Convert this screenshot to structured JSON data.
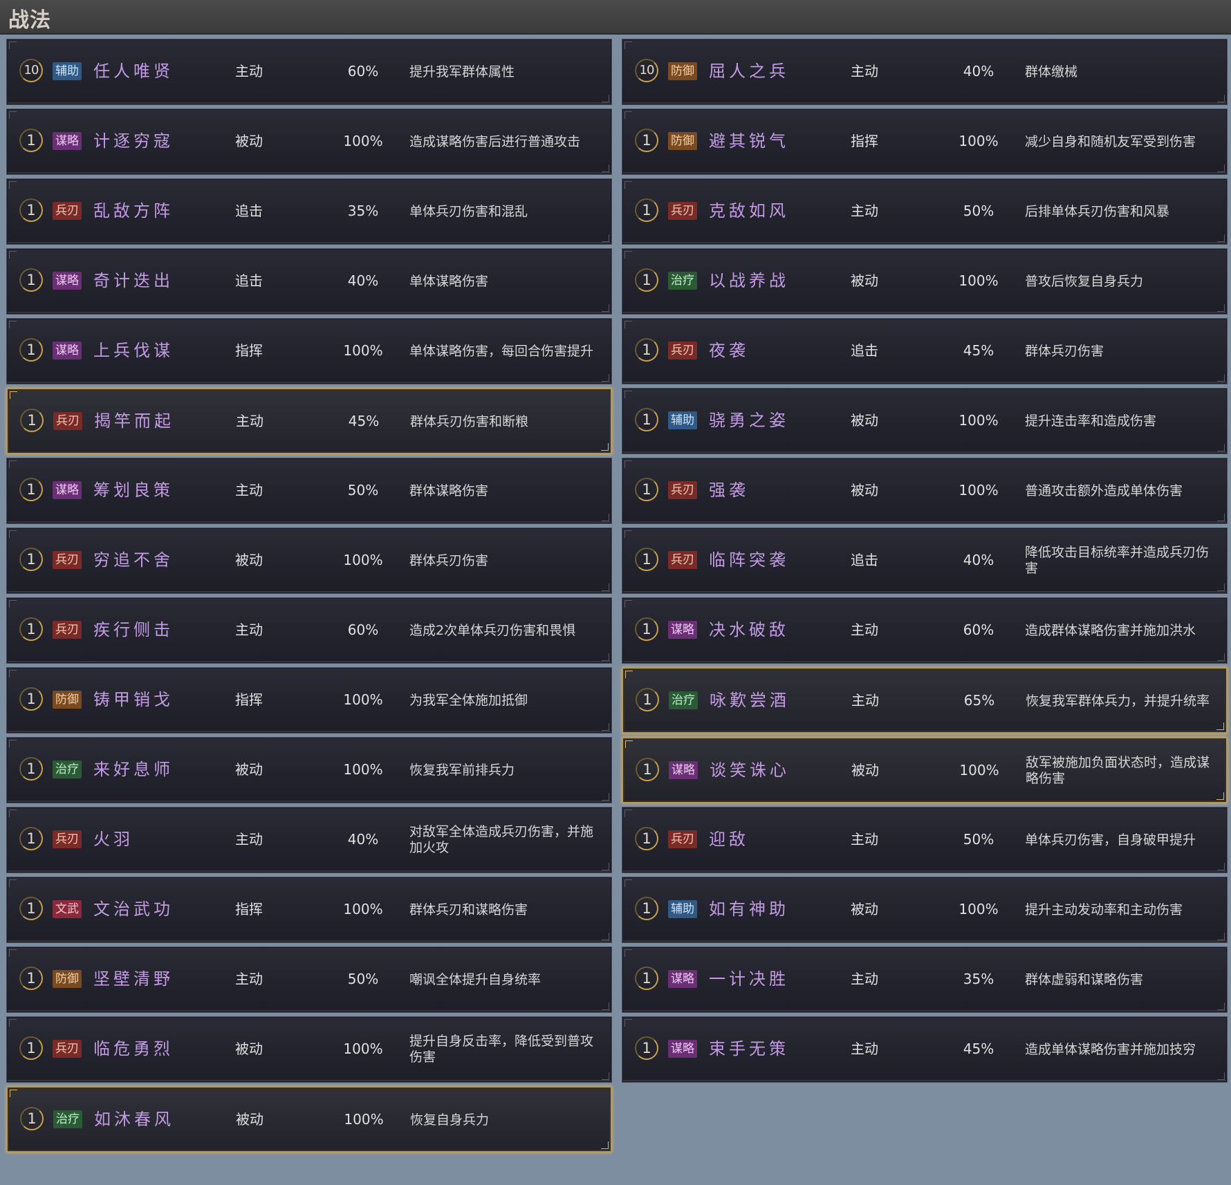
{
  "header": {
    "title": "战法"
  },
  "left_column": [
    {
      "level": "10",
      "tag": "辅助",
      "tag_kind": "support",
      "name": "任人唯贤",
      "type": "主动",
      "rate": "60%",
      "desc": "提升我军群体属性",
      "highlight": false
    },
    {
      "level": "1",
      "tag": "谋略",
      "tag_kind": "strategy",
      "name": "计逐穷寇",
      "type": "被动",
      "rate": "100%",
      "desc": "造成谋略伤害后进行普通攻击",
      "highlight": false
    },
    {
      "level": "1",
      "tag": "兵刃",
      "tag_kind": "blade",
      "name": "乱敌方阵",
      "type": "追击",
      "rate": "35%",
      "desc": "单体兵刃伤害和混乱",
      "highlight": false
    },
    {
      "level": "1",
      "tag": "谋略",
      "tag_kind": "strategy",
      "name": "奇计迭出",
      "type": "追击",
      "rate": "40%",
      "desc": "单体谋略伤害",
      "highlight": false
    },
    {
      "level": "1",
      "tag": "谋略",
      "tag_kind": "strategy",
      "name": "上兵伐谋",
      "type": "指挥",
      "rate": "100%",
      "desc": "单体谋略伤害，每回合伤害提升",
      "highlight": false
    },
    {
      "level": "1",
      "tag": "兵刃",
      "tag_kind": "blade",
      "name": "揭竿而起",
      "type": "主动",
      "rate": "45%",
      "desc": "群体兵刃伤害和断粮",
      "highlight": true
    },
    {
      "level": "1",
      "tag": "谋略",
      "tag_kind": "strategy",
      "name": "筹划良策",
      "type": "主动",
      "rate": "50%",
      "desc": "群体谋略伤害",
      "highlight": false
    },
    {
      "level": "1",
      "tag": "兵刃",
      "tag_kind": "blade",
      "name": "穷追不舍",
      "type": "被动",
      "rate": "100%",
      "desc": "群体兵刃伤害",
      "highlight": false
    },
    {
      "level": "1",
      "tag": "兵刃",
      "tag_kind": "blade",
      "name": "疾行侧击",
      "type": "主动",
      "rate": "60%",
      "desc": "造成2次单体兵刃伤害和畏惧",
      "highlight": false
    },
    {
      "level": "1",
      "tag": "防御",
      "tag_kind": "defense",
      "name": "铸甲销戈",
      "type": "指挥",
      "rate": "100%",
      "desc": "为我军全体施加抵御",
      "highlight": false
    },
    {
      "level": "1",
      "tag": "治疗",
      "tag_kind": "heal",
      "name": "来好息师",
      "type": "被动",
      "rate": "100%",
      "desc": "恢复我军前排兵力",
      "highlight": false
    },
    {
      "level": "1",
      "tag": "兵刃",
      "tag_kind": "blade",
      "name": "火羽",
      "type": "主动",
      "rate": "40%",
      "desc": "对敌军全体造成兵刃伤害，并施加火攻",
      "highlight": false
    },
    {
      "level": "1",
      "tag": "文武",
      "tag_kind": "civil",
      "name": "文治武功",
      "type": "指挥",
      "rate": "100%",
      "desc": "群体兵刃和谋略伤害",
      "highlight": false
    },
    {
      "level": "1",
      "tag": "防御",
      "tag_kind": "defense",
      "name": "坚壁清野",
      "type": "主动",
      "rate": "50%",
      "desc": "嘲讽全体提升自身统率",
      "highlight": false
    },
    {
      "level": "1",
      "tag": "兵刃",
      "tag_kind": "blade",
      "name": "临危勇烈",
      "type": "被动",
      "rate": "100%",
      "desc": "提升自身反击率，降低受到普攻伤害",
      "highlight": false
    },
    {
      "level": "1",
      "tag": "治疗",
      "tag_kind": "heal",
      "name": "如沐春风",
      "type": "被动",
      "rate": "100%",
      "desc": "恢复自身兵力",
      "highlight": true
    }
  ],
  "right_column": [
    {
      "level": "10",
      "tag": "防御",
      "tag_kind": "defense",
      "name": "屈人之兵",
      "type": "主动",
      "rate": "40%",
      "desc": "群体缴械",
      "highlight": false
    },
    {
      "level": "1",
      "tag": "防御",
      "tag_kind": "defense",
      "name": "避其锐气",
      "type": "指挥",
      "rate": "100%",
      "desc": "减少自身和随机友军受到伤害",
      "highlight": false
    },
    {
      "level": "1",
      "tag": "兵刃",
      "tag_kind": "blade",
      "name": "克敌如风",
      "type": "主动",
      "rate": "50%",
      "desc": "后排单体兵刃伤害和风暴",
      "highlight": false
    },
    {
      "level": "1",
      "tag": "治疗",
      "tag_kind": "heal",
      "name": "以战养战",
      "type": "被动",
      "rate": "100%",
      "desc": "普攻后恢复自身兵力",
      "highlight": false
    },
    {
      "level": "1",
      "tag": "兵刃",
      "tag_kind": "blade",
      "name": "夜袭",
      "type": "追击",
      "rate": "45%",
      "desc": "群体兵刃伤害",
      "highlight": false
    },
    {
      "level": "1",
      "tag": "辅助",
      "tag_kind": "support",
      "name": "骁勇之姿",
      "type": "被动",
      "rate": "100%",
      "desc": "提升连击率和造成伤害",
      "highlight": false
    },
    {
      "level": "1",
      "tag": "兵刃",
      "tag_kind": "blade",
      "name": "强袭",
      "type": "被动",
      "rate": "100%",
      "desc": "普通攻击额外造成单体伤害",
      "highlight": false
    },
    {
      "level": "1",
      "tag": "兵刃",
      "tag_kind": "blade",
      "name": "临阵突袭",
      "type": "追击",
      "rate": "40%",
      "desc": "降低攻击目标统率并造成兵刃伤害",
      "highlight": false
    },
    {
      "level": "1",
      "tag": "谋略",
      "tag_kind": "strategy",
      "name": "决水破敌",
      "type": "主动",
      "rate": "60%",
      "desc": "造成群体谋略伤害并施加洪水",
      "highlight": false
    },
    {
      "level": "1",
      "tag": "治疗",
      "tag_kind": "heal",
      "name": "咏歎尝酒",
      "type": "主动",
      "rate": "65%",
      "desc": "恢复我军群体兵力，并提升统率",
      "highlight": true
    },
    {
      "level": "1",
      "tag": "谋略",
      "tag_kind": "strategy",
      "name": "谈笑诛心",
      "type": "被动",
      "rate": "100%",
      "desc": "敌军被施加负面状态时，造成谋略伤害",
      "highlight": true
    },
    {
      "level": "1",
      "tag": "兵刃",
      "tag_kind": "blade",
      "name": "迎敌",
      "type": "主动",
      "rate": "50%",
      "desc": "单体兵刃伤害，自身破甲提升",
      "highlight": false
    },
    {
      "level": "1",
      "tag": "辅助",
      "tag_kind": "support",
      "name": "如有神助",
      "type": "被动",
      "rate": "100%",
      "desc": "提升主动发动率和主动伤害",
      "highlight": false
    },
    {
      "level": "1",
      "tag": "谋略",
      "tag_kind": "strategy",
      "name": "一计决胜",
      "type": "主动",
      "rate": "35%",
      "desc": "群体虚弱和谋略伤害",
      "highlight": false
    },
    {
      "level": "1",
      "tag": "谋略",
      "tag_kind": "strategy",
      "name": "束手无策",
      "type": "主动",
      "rate": "45%",
      "desc": "造成单体谋略伤害并施加技穷",
      "highlight": false
    }
  ]
}
